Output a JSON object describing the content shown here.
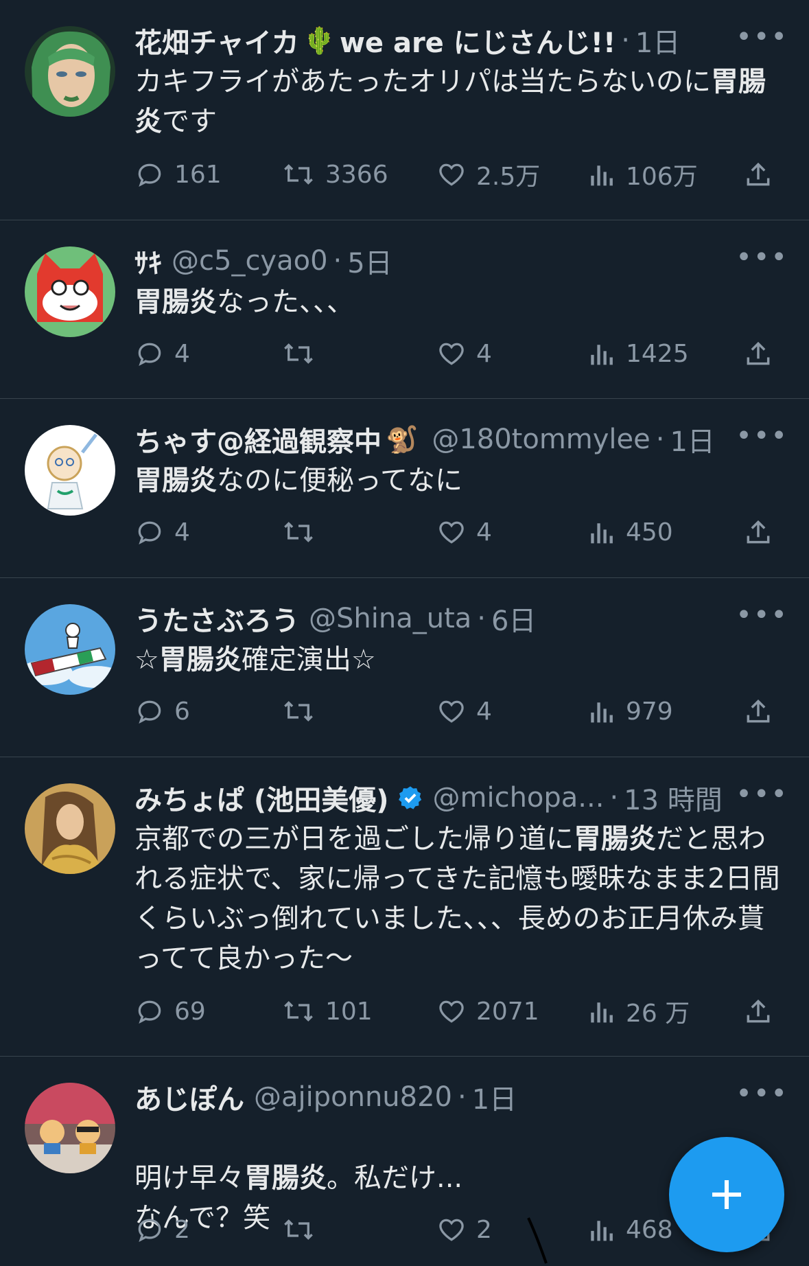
{
  "tweets": [
    {
      "name": "花畑チャイカ",
      "name_emoji": "🌵",
      "name_suffix": "we are にじさんじ!!",
      "handle": "",
      "time": "1日",
      "text": [
        {
          "t": "カキフライがあたったオリパは当たらないのに",
          "b": false
        },
        {
          "t": "胃腸炎",
          "b": true
        },
        {
          "t": "です",
          "b": false
        }
      ],
      "replies": "161",
      "retweets": "3366",
      "likes": "2.5万",
      "views": "106万"
    },
    {
      "name": "ｻｷ",
      "handle": "@c5_cyao0",
      "time": "5日",
      "text": [
        {
          "t": "胃腸炎",
          "b": true
        },
        {
          "t": "なった、、、",
          "b": false
        }
      ],
      "replies": "4",
      "retweets": "",
      "likes": "4",
      "views": "1425"
    },
    {
      "name": "ちゃす@経過観察中",
      "name_emoji": "🐒",
      "handle": "@180tommylee",
      "time": "1日",
      "text": [
        {
          "t": "胃腸炎",
          "b": true
        },
        {
          "t": "なのに便秘ってなに",
          "b": false
        }
      ],
      "replies": "4",
      "retweets": "",
      "likes": "4",
      "views": "450"
    },
    {
      "name": "うたさぶろう",
      "handle": "@Shina_uta",
      "time": "6日",
      "text": [
        {
          "t": "☆",
          "b": false
        },
        {
          "t": "胃腸炎",
          "b": true
        },
        {
          "t": "確定演出☆",
          "b": false
        }
      ],
      "replies": "6",
      "retweets": "",
      "likes": "4",
      "views": "979"
    },
    {
      "name": "みちょぱ (池田美優)",
      "verified": true,
      "handle": "@michopa...",
      "time": "13 時間",
      "text": [
        {
          "t": "京都での三が日を過ごした帰り道に",
          "b": false
        },
        {
          "t": "胃腸炎",
          "b": true
        },
        {
          "t": "だと思われる症状で、家に帰ってきた記憶も曖昧なまま2日間くらいぶっ倒れていました、、、長めのお正月休み貰ってて良かった〜",
          "b": false
        }
      ],
      "replies": "69",
      "retweets": "101",
      "likes": "2071",
      "views": "26 万"
    },
    {
      "name": "あじぽん",
      "handle": "@ajiponnu820",
      "time": "1日",
      "text": [
        {
          "t": "明け早々",
          "b": false
        },
        {
          "t": "胃腸炎",
          "b": true
        },
        {
          "t": "。私だけ...\nなんで？笑",
          "b": false
        }
      ],
      "replies": "2",
      "retweets": "",
      "likes": "2",
      "views": "468"
    }
  ],
  "dot": "·",
  "more": "•••",
  "icons": {
    "reply": "speech-bubble-icon",
    "retweet": "retweet-arrows-icon",
    "like": "heart-icon",
    "views": "bar-chart-icon",
    "share": "share-upload-icon",
    "compose": "plus-icon",
    "verified": "blue-check-badge-icon"
  },
  "colors": {
    "background": "#15202b",
    "text": "#e7e9ea",
    "secondary": "#8b98a5",
    "accent": "#1d9bf0",
    "divider": "#38444d"
  }
}
